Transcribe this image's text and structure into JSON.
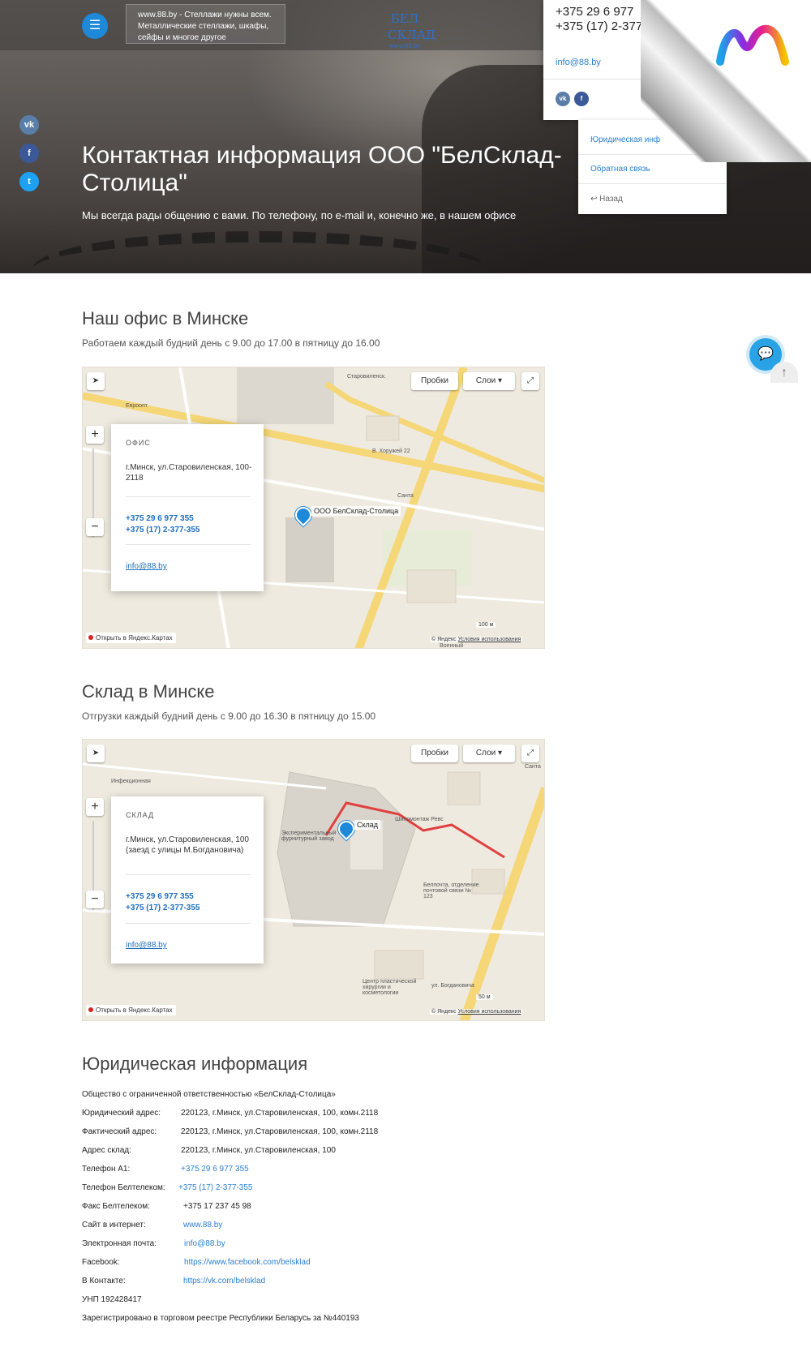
{
  "header": {
    "tagline": "www.88.by - Стеллажи нужны всем. Металлические стеллажи, шкафы, сейфы и многое другое",
    "logo_text": "БЕЛ СКЛАД",
    "logo_sub": "www.88.by",
    "menu_icon": "hamburger-icon"
  },
  "contact_dropdown": {
    "phone1": "+375 29 6 977",
    "phone2": "+375 (17) 2-377",
    "email": "info@88.by",
    "social": [
      "vk",
      "f"
    ]
  },
  "submenu": {
    "items": [
      "Юридическая инф",
      "Обратная связь"
    ],
    "back": "Назад"
  },
  "social_left": [
    "vk",
    "f",
    "t"
  ],
  "hero": {
    "title": "Контактная информация ООО \"БелСклад-Столица\"",
    "subtitle": "Мы всегда рады общению с вами. По телефону, по e-mail и, конечно же, в нашем офисе"
  },
  "office": {
    "title": "Наш офис в Минске",
    "subtitle": "Работаем каждый будний день с 9.00 до 17.00 в пятницу до 16.00",
    "map": {
      "traffic": "Пробки",
      "layers": "Слои",
      "pin_label": "ООО БелСклад-Столица",
      "open_yandex": "Открыть в Яндекс.Картах",
      "copyright": "© Яндекс",
      "terms": "Условия использования",
      "scale": "100 м",
      "places": [
        "Евроопт",
        "В. Хоружей 22",
        "Санта",
        "Старовиленск.",
        "Военный"
      ]
    },
    "card": {
      "label": "ОФИС",
      "address": "г.Минск, ул.Старовиленская, 100-2118",
      "phone1": "+375 29 6 977 355",
      "phone2": "+375 (17) 2-377-355",
      "email": "info@88.by"
    }
  },
  "warehouse": {
    "title": "Склад в Минске",
    "subtitle": "Отгрузки каждый будний день с 9.00 до 16.30 в пятницу до 15.00",
    "map": {
      "traffic": "Пробки",
      "layers": "Слои",
      "pin_label": "Склад",
      "open_yandex": "Открыть в Яндекс.Картах",
      "copyright": "© Яндекс",
      "terms": "Условия использования",
      "scale": "50 м",
      "places": [
        "Инфекционная",
        "Экспериментальный фурнитурный завод",
        "Шиномонтаж Ревс",
        "Белпочта, отделение почтовой связи № 123",
        "Центр пластической хирургии и косметологии",
        "ул. Богдановича",
        "Санта"
      ]
    },
    "card": {
      "label": "СКЛАД",
      "address": "г.Минск, ул.Старовиленская, 100 (заезд с улицы М.Богдановича)",
      "phone1": "+375 29 6 977 355",
      "phone2": "+375 (17) 2-377-355",
      "email": "info@88.by"
    }
  },
  "legal": {
    "title": "Юридическая информация",
    "company": "Общество с ограниченной ответственностью «БелСклад-Столица»",
    "rows": [
      {
        "k": "Юридический адрес:",
        "v": "220123, г.Минск, ул.Старовиленская, 100, комн.2118",
        "link": false
      },
      {
        "k": "Фактический адрес:",
        "v": "220123, г.Минск, ул.Старовиленская, 100, комн.2118",
        "link": false
      },
      {
        "k": "Адрес склад:",
        "v": "220123, г.Минск, ул.Старовиленская, 100",
        "link": false
      },
      {
        "k": "Телефон А1:",
        "v": "+375 29 6 977 355",
        "link": true
      },
      {
        "k": "Телефон Белтелеком:",
        "v": "+375 (17) 2-377-355",
        "link": true
      },
      {
        "k": "Факс Белтелеком:",
        "v": "+375 17 237 45 98",
        "link": false
      },
      {
        "k": "Сайт в интернет:",
        "v": "www.88.by",
        "link": true
      },
      {
        "k": "Электронная почта:",
        "v": "info@88.by",
        "link": true
      },
      {
        "k": "Facebook:",
        "v": "https://www.facebook.com/belsklad",
        "link": true
      },
      {
        "k": "В Контакте:",
        "v": "https://vk.com/belsklad",
        "link": true
      }
    ],
    "unp": "УНП 192428417",
    "registry": "Зарегистрировано в торговом реестре Республики Беларусь за №440193"
  },
  "colors": {
    "accent": "#1e88d9",
    "link": "#2a7fd0",
    "route": "#e04040"
  }
}
